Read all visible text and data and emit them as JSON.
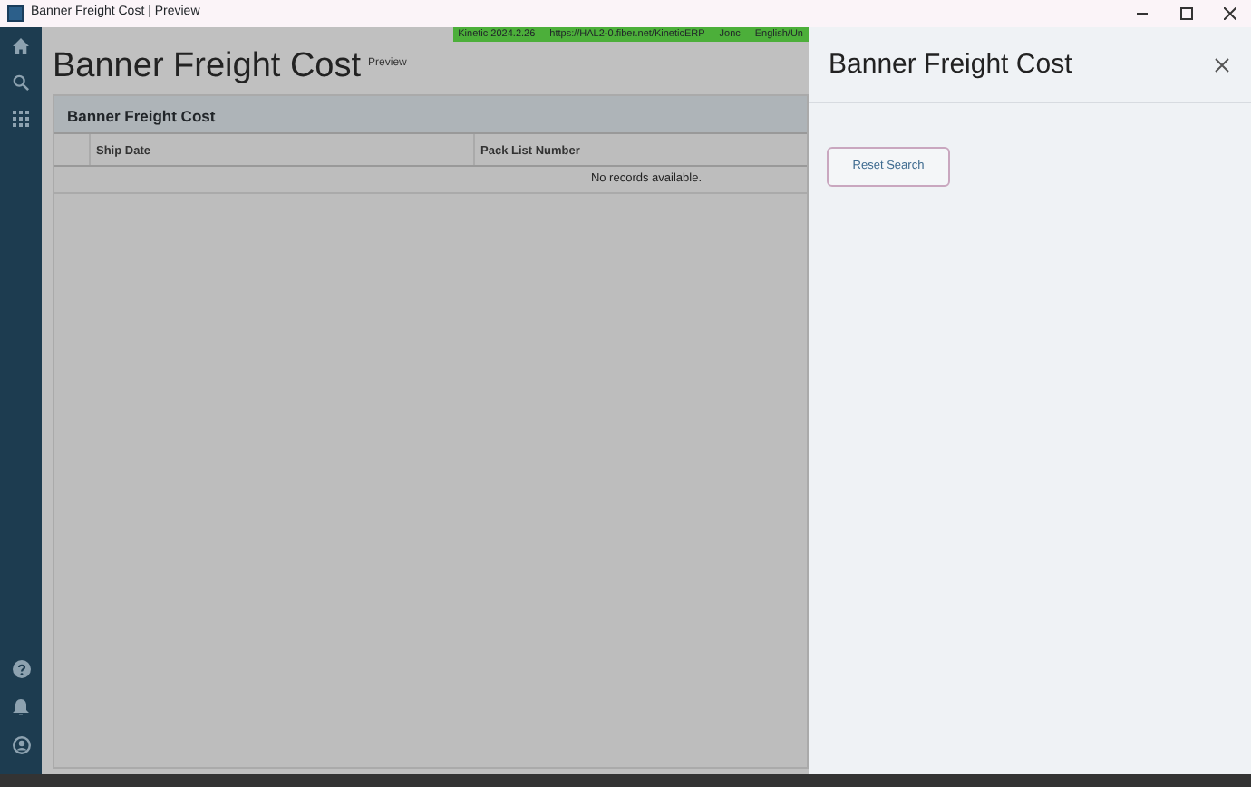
{
  "window": {
    "title": "Banner Freight Cost | Preview"
  },
  "status_bar": [
    "Kinetic 2024.2.26",
    "https://HAL2-0.fiber.net/KineticERP",
    "Jonc",
    "English/Un"
  ],
  "page": {
    "title": "Banner Freight Cost",
    "subtitle": "Preview"
  },
  "grid": {
    "title": "Banner Freight Cost",
    "columns": [
      "Ship Date",
      "Pack List Number"
    ],
    "empty_message": "No records available."
  },
  "panel": {
    "title": "Banner Freight Cost",
    "buttons": [
      "Reset Search"
    ]
  }
}
